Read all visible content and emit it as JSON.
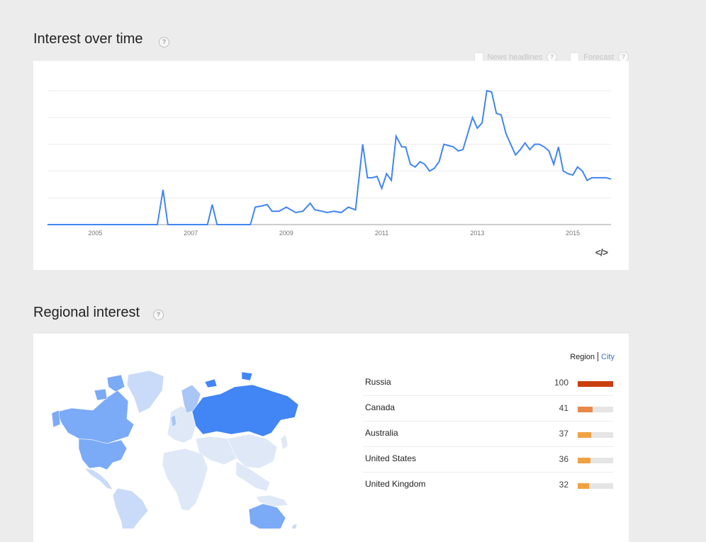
{
  "interest_over_time": {
    "title": "Interest over time",
    "help": "?",
    "options": [
      {
        "label": "News headlines",
        "checked": false
      },
      {
        "label": "Forecast",
        "checked": false
      }
    ],
    "embed_icon": "</>",
    "embed_icon_name": "embed-code-icon",
    "line_color": "#4285f4"
  },
  "chart_data": {
    "type": "line",
    "x_tick_labels": [
      "2005",
      "2007",
      "2009",
      "2011",
      "2013",
      "2015"
    ],
    "x_ticks": [
      2005,
      2007,
      2009,
      2011,
      2013,
      2015
    ],
    "xlim": [
      2004.0,
      2015.8
    ],
    "ylim": [
      0,
      100
    ],
    "grid": true,
    "series": [
      {
        "x": [
          2004.0,
          2005.0,
          2006.0,
          2006.3,
          2006.42,
          2006.52,
          2007.0,
          2007.35,
          2007.45,
          2007.55,
          2008.0,
          2008.25,
          2008.35,
          2008.5,
          2008.6,
          2008.7,
          2008.85,
          2009.0,
          2009.1,
          2009.2,
          2009.35,
          2009.5,
          2009.6,
          2009.75,
          2009.85,
          2010.0,
          2010.15,
          2010.3,
          2010.45,
          2010.6,
          2010.7,
          2010.8,
          2010.9,
          2011.0,
          2011.1,
          2011.2,
          2011.3,
          2011.42,
          2011.5,
          2011.6,
          2011.7,
          2011.8,
          2011.9,
          2012.0,
          2012.1,
          2012.2,
          2012.3,
          2012.4,
          2012.5,
          2012.6,
          2012.7,
          2012.8,
          2012.9,
          2013.0,
          2013.1,
          2013.2,
          2013.3,
          2013.4,
          2013.5,
          2013.6,
          2013.7,
          2013.8,
          2013.9,
          2014.0,
          2014.1,
          2014.2,
          2014.3,
          2014.4,
          2014.5,
          2014.6,
          2014.7,
          2014.8,
          2014.9,
          2015.0,
          2015.1,
          2015.2,
          2015.3,
          2015.4,
          2015.5,
          2015.6,
          2015.7,
          2015.8
        ],
        "values": [
          0,
          0,
          0,
          0,
          26,
          0,
          0,
          0,
          15,
          0,
          0,
          0,
          13,
          14,
          15,
          10,
          10,
          13,
          11,
          9,
          10,
          16,
          11,
          10,
          9,
          10,
          9,
          13,
          11,
          60,
          35,
          35,
          36,
          27,
          38,
          33,
          66,
          58,
          58,
          45,
          43,
          47,
          45,
          40,
          42,
          47,
          60,
          59,
          58,
          55,
          56,
          68,
          80,
          72,
          76,
          100,
          99,
          83,
          82,
          68,
          60,
          52,
          56,
          61,
          56,
          60,
          60,
          58,
          55,
          45,
          58,
          40,
          38,
          37,
          43,
          40,
          33,
          35,
          35,
          35,
          35,
          34
        ]
      }
    ]
  },
  "regional_interest": {
    "title": "Regional interest",
    "help": "?",
    "toggle": {
      "active": "Region",
      "link": "City"
    },
    "map_colors": {
      "max": "#4285f4",
      "mid": "#7baaf7",
      "low": "#a9c6f6",
      "lowest": "#c9dbf8",
      "none": "#dfe8f7"
    },
    "regions": [
      {
        "name": "Russia",
        "value": 100,
        "fraction": 1.0,
        "color": "#c9400f"
      },
      {
        "name": "Canada",
        "value": 41,
        "fraction": 0.41,
        "color": "#e8894a"
      },
      {
        "name": "Australia",
        "value": 37,
        "fraction": 0.37,
        "color": "#f0a243"
      },
      {
        "name": "United States",
        "value": 36,
        "fraction": 0.36,
        "color": "#f0a243"
      },
      {
        "name": "United Kingdom",
        "value": 32,
        "fraction": 0.32,
        "color": "#f0a243"
      }
    ]
  }
}
